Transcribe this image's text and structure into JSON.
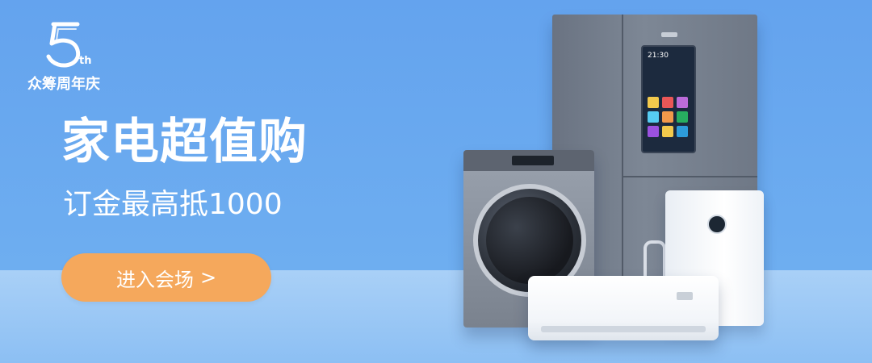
{
  "logo": {
    "numeral": "5",
    "suffix": "th",
    "text": "众筹周年庆"
  },
  "hero": {
    "title": "家电超值购",
    "subtitle": "订金最高抵1000",
    "cta_label": "进入会场",
    "cta_arrow": ">"
  },
  "fridge_screen": {
    "time": "21:30"
  },
  "colors": {
    "background": "#6aa8ee",
    "floor": "#a9d0f7",
    "cta": "#f5a85c",
    "text": "#ffffff"
  }
}
